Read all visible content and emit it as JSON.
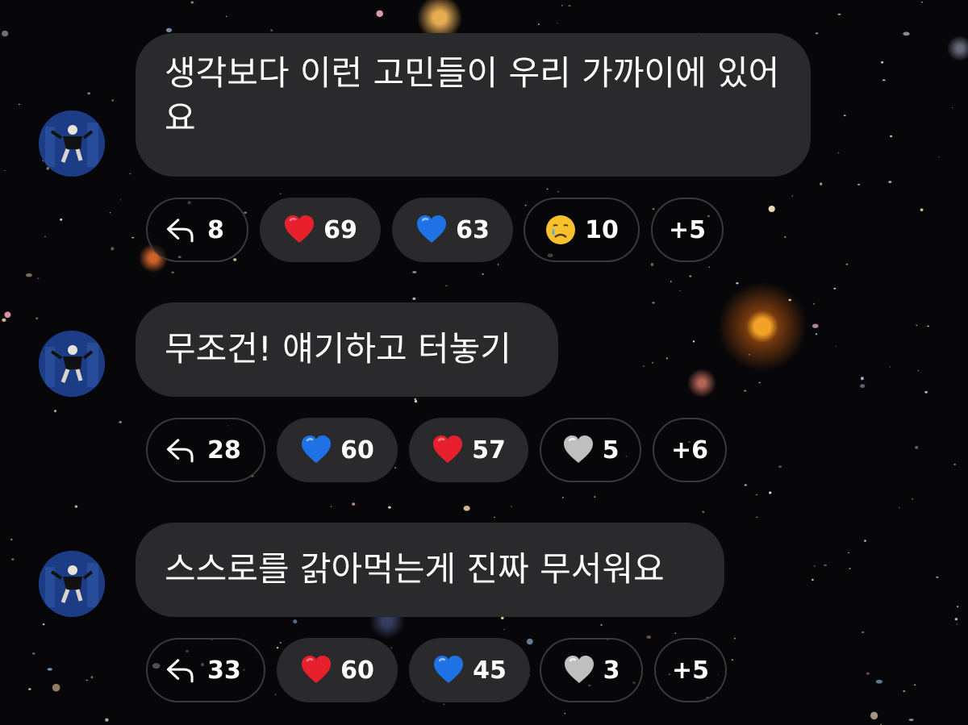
{
  "colors": {
    "bubble_bg": "#2a2a2c",
    "pill_border": "#3a3a3d",
    "red_heart": "#e8202e",
    "blue_heart": "#1f72e6",
    "grey_heart": "#bfbfbf"
  },
  "comments": [
    {
      "text": "생각보다 이런 고민들이 우리 가까이에 있어요",
      "reply_count": "8",
      "reactions": [
        {
          "emoji": "red-heart",
          "count": "69"
        },
        {
          "emoji": "blue-heart",
          "count": "63"
        },
        {
          "emoji": "crying-face",
          "count": "10"
        }
      ],
      "more": "+5"
    },
    {
      "text": "무조건! 얘기하고 터놓기",
      "reply_count": "28",
      "reactions": [
        {
          "emoji": "blue-heart",
          "count": "60"
        },
        {
          "emoji": "red-heart",
          "count": "57"
        },
        {
          "emoji": "grey-heart",
          "count": "5"
        }
      ],
      "more": "+6"
    },
    {
      "text": "스스로를 갉아먹는게 진짜 무서워요",
      "reply_count": "33",
      "reactions": [
        {
          "emoji": "red-heart",
          "count": "60"
        },
        {
          "emoji": "blue-heart",
          "count": "45"
        },
        {
          "emoji": "grey-heart",
          "count": "3"
        }
      ],
      "more": "+5"
    }
  ]
}
